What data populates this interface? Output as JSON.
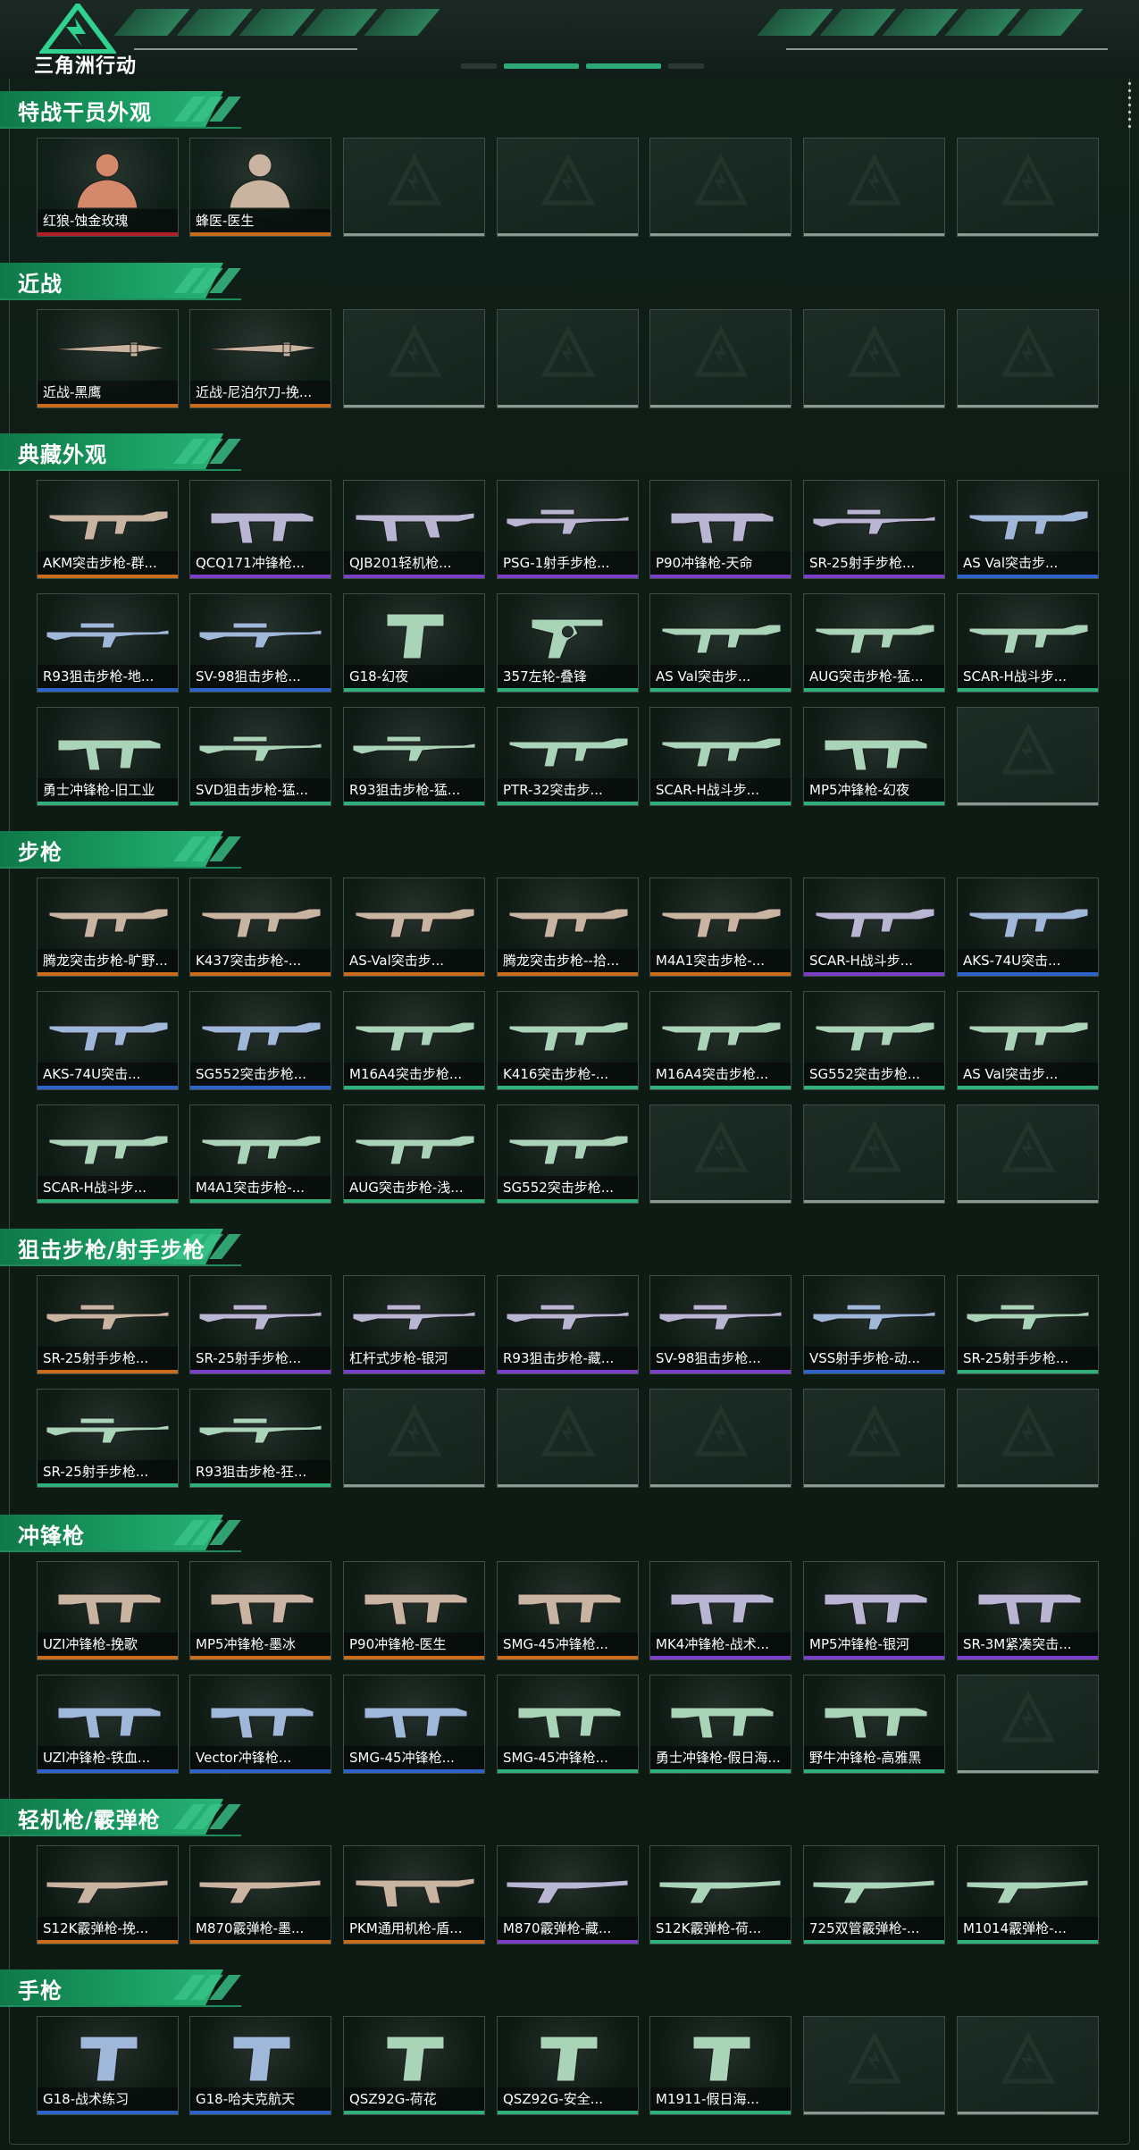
{
  "header": {
    "game_name": "三角洲行动"
  },
  "colors": {
    "accent": "#1a9e63",
    "rarity_red": "#b11f28",
    "rarity_orange": "#c96d1c",
    "rarity_purple": "#7b3fc7",
    "rarity_blue": "#2f63c9",
    "rarity_green": "#2fb07a"
  },
  "sections": [
    {
      "title": "特战干员外观",
      "items": [
        {
          "label": "红狼-蚀金玫瑰",
          "rarity": "red",
          "icon": "operator-portrait"
        },
        {
          "label": "蜂医-医生",
          "rarity": "orange",
          "icon": "operator-portrait"
        },
        null,
        null,
        null,
        null,
        null
      ]
    },
    {
      "title": "近战",
      "items": [
        {
          "label": "近战-黑鹰",
          "rarity": "orange",
          "icon": "knife"
        },
        {
          "label": "近战-尼泊尔刀-挽...",
          "rarity": "orange",
          "icon": "knife"
        },
        null,
        null,
        null,
        null,
        null
      ]
    },
    {
      "title": "典藏外观",
      "items": [
        {
          "label": "AKM突击步枪-群...",
          "rarity": "orange",
          "icon": "rifle"
        },
        {
          "label": "QCQ171冲锋枪...",
          "rarity": "purple",
          "icon": "smg"
        },
        {
          "label": "QJB201轻机枪...",
          "rarity": "purple",
          "icon": "lmg"
        },
        {
          "label": "PSG-1射手步枪...",
          "rarity": "purple",
          "icon": "sniper"
        },
        {
          "label": "P90冲锋枪-天命",
          "rarity": "purple",
          "icon": "smg"
        },
        {
          "label": "SR-25射手步枪...",
          "rarity": "purple",
          "icon": "sniper"
        },
        {
          "label": "AS Val突击步...",
          "rarity": "blue",
          "icon": "rifle"
        },
        {
          "label": "R93狙击步枪-地...",
          "rarity": "blue",
          "icon": "sniper"
        },
        {
          "label": "SV-98狙击步枪...",
          "rarity": "blue",
          "icon": "sniper"
        },
        {
          "label": "G18-幻夜",
          "rarity": "green",
          "icon": "pistol"
        },
        {
          "label": "357左轮-叠锋",
          "rarity": "green",
          "icon": "revolver"
        },
        {
          "label": "AS Val突击步...",
          "rarity": "green",
          "icon": "rifle"
        },
        {
          "label": "AUG突击步枪-猛...",
          "rarity": "green",
          "icon": "rifle"
        },
        {
          "label": "SCAR-H战斗步...",
          "rarity": "green",
          "icon": "rifle"
        },
        {
          "label": "勇士冲锋枪-旧工业",
          "rarity": "green",
          "icon": "smg"
        },
        {
          "label": "SVD狙击步枪-猛...",
          "rarity": "green",
          "icon": "sniper"
        },
        {
          "label": "R93狙击步枪-猛...",
          "rarity": "green",
          "icon": "sniper"
        },
        {
          "label": "PTR-32突击步...",
          "rarity": "green",
          "icon": "rifle"
        },
        {
          "label": "SCAR-H战斗步...",
          "rarity": "green",
          "icon": "rifle"
        },
        {
          "label": "MP5冲锋枪-幻夜",
          "rarity": "green",
          "icon": "smg"
        },
        null
      ]
    },
    {
      "title": "步枪",
      "items": [
        {
          "label": "腾龙突击步枪-旷野...",
          "rarity": "orange",
          "icon": "rifle"
        },
        {
          "label": "K437突击步枪-...",
          "rarity": "orange",
          "icon": "rifle"
        },
        {
          "label": "AS-Val突击步...",
          "rarity": "orange",
          "icon": "rifle"
        },
        {
          "label": "腾龙突击步枪--拾...",
          "rarity": "orange",
          "icon": "rifle"
        },
        {
          "label": "M4A1突击步枪-...",
          "rarity": "orange",
          "icon": "rifle"
        },
        {
          "label": "SCAR-H战斗步...",
          "rarity": "purple",
          "icon": "rifle"
        },
        {
          "label": "AKS-74U突击...",
          "rarity": "blue",
          "icon": "rifle"
        },
        {
          "label": "AKS-74U突击...",
          "rarity": "blue",
          "icon": "rifle"
        },
        {
          "label": "SG552突击步枪...",
          "rarity": "blue",
          "icon": "rifle"
        },
        {
          "label": "M16A4突击步枪...",
          "rarity": "green",
          "icon": "rifle"
        },
        {
          "label": "K416突击步枪-...",
          "rarity": "green",
          "icon": "rifle"
        },
        {
          "label": "M16A4突击步枪...",
          "rarity": "green",
          "icon": "rifle"
        },
        {
          "label": "SG552突击步枪...",
          "rarity": "green",
          "icon": "rifle"
        },
        {
          "label": "AS Val突击步...",
          "rarity": "green",
          "icon": "rifle"
        },
        {
          "label": "SCAR-H战斗步...",
          "rarity": "green",
          "icon": "rifle"
        },
        {
          "label": "M4A1突击步枪-...",
          "rarity": "green",
          "icon": "rifle"
        },
        {
          "label": "AUG突击步枪-浅...",
          "rarity": "green",
          "icon": "rifle"
        },
        {
          "label": "SG552突击步枪...",
          "rarity": "green",
          "icon": "rifle"
        },
        null,
        null,
        null
      ]
    },
    {
      "title": "狙击步枪/射手步枪",
      "items": [
        {
          "label": "SR-25射手步枪...",
          "rarity": "orange",
          "icon": "sniper"
        },
        {
          "label": "SR-25射手步枪...",
          "rarity": "purple",
          "icon": "sniper"
        },
        {
          "label": "杠杆式步枪-银河",
          "rarity": "purple",
          "icon": "sniper"
        },
        {
          "label": "R93狙击步枪-藏...",
          "rarity": "purple",
          "icon": "sniper"
        },
        {
          "label": "SV-98狙击步枪...",
          "rarity": "purple",
          "icon": "sniper"
        },
        {
          "label": "VSS射手步枪-动...",
          "rarity": "blue",
          "icon": "sniper"
        },
        {
          "label": "SR-25射手步枪...",
          "rarity": "green",
          "icon": "sniper"
        },
        {
          "label": "SR-25射手步枪...",
          "rarity": "green",
          "icon": "sniper"
        },
        {
          "label": "R93狙击步枪-狂...",
          "rarity": "green",
          "icon": "sniper"
        },
        null,
        null,
        null,
        null,
        null
      ]
    },
    {
      "title": "冲锋枪",
      "items": [
        {
          "label": "UZI冲锋枪-挽歌",
          "rarity": "orange",
          "icon": "smg"
        },
        {
          "label": "MP5冲锋枪-墨冰",
          "rarity": "orange",
          "icon": "smg"
        },
        {
          "label": "P90冲锋枪-医生",
          "rarity": "orange",
          "icon": "smg"
        },
        {
          "label": "SMG-45冲锋枪...",
          "rarity": "orange",
          "icon": "smg"
        },
        {
          "label": "MK4冲锋枪-战术...",
          "rarity": "purple",
          "icon": "smg"
        },
        {
          "label": "MP5冲锋枪-银河",
          "rarity": "purple",
          "icon": "smg"
        },
        {
          "label": "SR-3M紧凑突击...",
          "rarity": "purple",
          "icon": "smg"
        },
        {
          "label": "UZI冲锋枪-铁血...",
          "rarity": "blue",
          "icon": "smg"
        },
        {
          "label": "Vector冲锋枪...",
          "rarity": "blue",
          "icon": "smg"
        },
        {
          "label": "SMG-45冲锋枪...",
          "rarity": "blue",
          "icon": "smg"
        },
        {
          "label": "SMG-45冲锋枪...",
          "rarity": "green",
          "icon": "smg"
        },
        {
          "label": "勇士冲锋枪-假日海...",
          "rarity": "green",
          "icon": "smg"
        },
        {
          "label": "野牛冲锋枪-高雅黑",
          "rarity": "green",
          "icon": "smg"
        },
        null
      ]
    },
    {
      "title": "轻机枪/霰弹枪",
      "items": [
        {
          "label": "S12K霰弹枪-挽...",
          "rarity": "orange",
          "icon": "shotgun"
        },
        {
          "label": "M870霰弹枪-墨...",
          "rarity": "orange",
          "icon": "shotgun"
        },
        {
          "label": "PKM通用机枪-盾...",
          "rarity": "orange",
          "icon": "lmg"
        },
        {
          "label": "M870霰弹枪-藏...",
          "rarity": "purple",
          "icon": "shotgun"
        },
        {
          "label": "S12K霰弹枪-荷...",
          "rarity": "green",
          "icon": "shotgun"
        },
        {
          "label": "725双管霰弹枪-...",
          "rarity": "green",
          "icon": "shotgun"
        },
        {
          "label": "M1014霰弹枪-...",
          "rarity": "green",
          "icon": "shotgun"
        }
      ]
    },
    {
      "title": "手枪",
      "items": [
        {
          "label": "G18-战术练习",
          "rarity": "blue",
          "icon": "pistol"
        },
        {
          "label": "G18-哈夫克航天",
          "rarity": "blue",
          "icon": "pistol"
        },
        {
          "label": "QSZ92G-荷花",
          "rarity": "green",
          "icon": "pistol"
        },
        {
          "label": "QSZ92G-安全...",
          "rarity": "green",
          "icon": "pistol"
        },
        {
          "label": "M1911-假日海...",
          "rarity": "green",
          "icon": "pistol"
        },
        null,
        null
      ]
    }
  ]
}
